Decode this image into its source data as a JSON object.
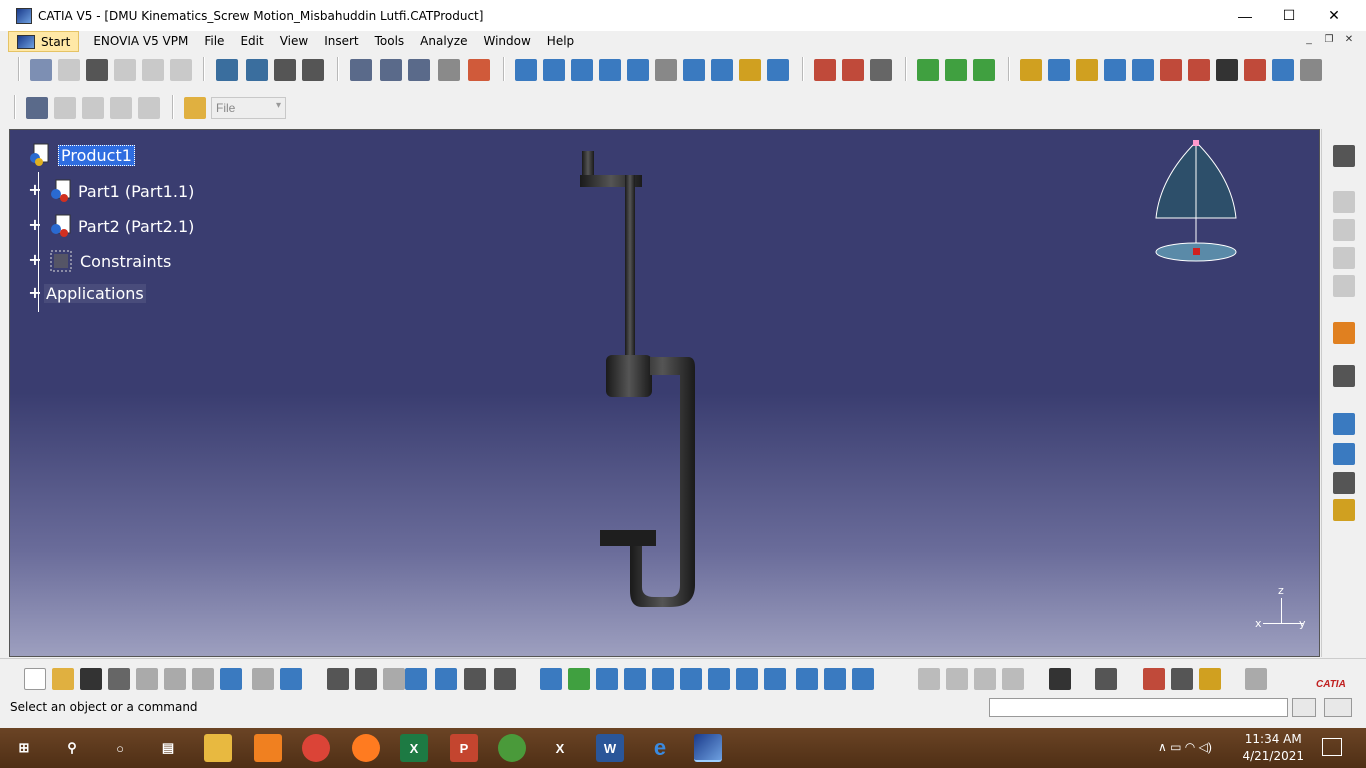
{
  "window": {
    "title": "CATIA V5 - [DMU Kinematics_Screw Motion_Misbahuddin Lutfi.CATProduct]",
    "minimize": "—",
    "maximize": "☐",
    "close": "✕"
  },
  "menu": {
    "start": "Start",
    "items": [
      "ENOVIA V5 VPM",
      "File",
      "Edit",
      "View",
      "Insert",
      "Tools",
      "Analyze",
      "Window",
      "Help"
    ]
  },
  "toolbar": {
    "file_select": "File"
  },
  "tree": {
    "root": "Product1",
    "nodes": [
      "Part1 (Part1.1)",
      "Part2 (Part2.1)",
      "Constraints",
      "Applications"
    ]
  },
  "compass": {
    "z": "z",
    "x": "x",
    "y": "y"
  },
  "status": {
    "message": "Select an object or a command",
    "catia_brand": "CATIA"
  },
  "taskbar": {
    "time": "11:34 AM",
    "date": "4/21/2021"
  },
  "colors": {
    "viewport_top": "#3a3d70",
    "viewport_bottom": "#9d9fbf",
    "selection": "#2f6de0",
    "taskbar": "#5e3a1e"
  }
}
